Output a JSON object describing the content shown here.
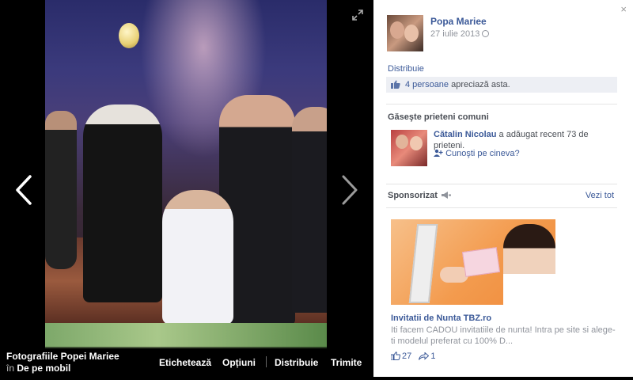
{
  "stage": {
    "album_title": "Fotografiile Popei Mariee",
    "album_prefix": "în",
    "album_source": "De pe mobil",
    "actions": {
      "tag": "Etichetează",
      "options": "Opțiuni",
      "share": "Distribuie",
      "send": "Trimite"
    },
    "icons": {
      "prev": "chevron-left-icon",
      "next": "chevron-right-icon",
      "expand": "expand-icon"
    }
  },
  "panel": {
    "close_label": "×",
    "owner": {
      "name": "Popa Mariee",
      "date": "27 iulie 2013"
    },
    "share_label": "Distribuie",
    "likes": {
      "count_text": "4 persoane",
      "suffix": " apreciază asta."
    },
    "mutual": {
      "heading": "Găseşte prieteni comuni",
      "friend_name": "Cătalin Nicolau",
      "friend_action": " a adăugat recent 73 de prieteni.",
      "know_someone": "Cunoşti pe cineva?"
    },
    "sponsored": {
      "label": "Sponsorizat",
      "see_all": "Vezi tot",
      "ad_title": "Invitatii de Nunta TBZ.ro",
      "ad_desc": "Iti facem CADOU invitatiile de nunta! Intra pe site si alege-ti modelul preferat cu 100% D...",
      "ad_likes": "27",
      "ad_shares": "1"
    }
  },
  "colors": {
    "link": "#3b5998",
    "muted": "#90949c",
    "likes_bg": "#edeff4"
  }
}
